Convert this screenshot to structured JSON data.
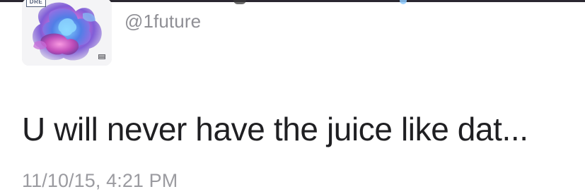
{
  "tweet": {
    "handle": "@1future",
    "text": "U will never have the juice like dat...",
    "timestamp": "11/10/15, 4:21 PM",
    "avatar_logo_text": "DRE"
  },
  "colors": {
    "handle": "#8f8f95",
    "text": "#1f1f22",
    "timestamp": "#9b9ba0",
    "verified": "#8ecbff"
  }
}
